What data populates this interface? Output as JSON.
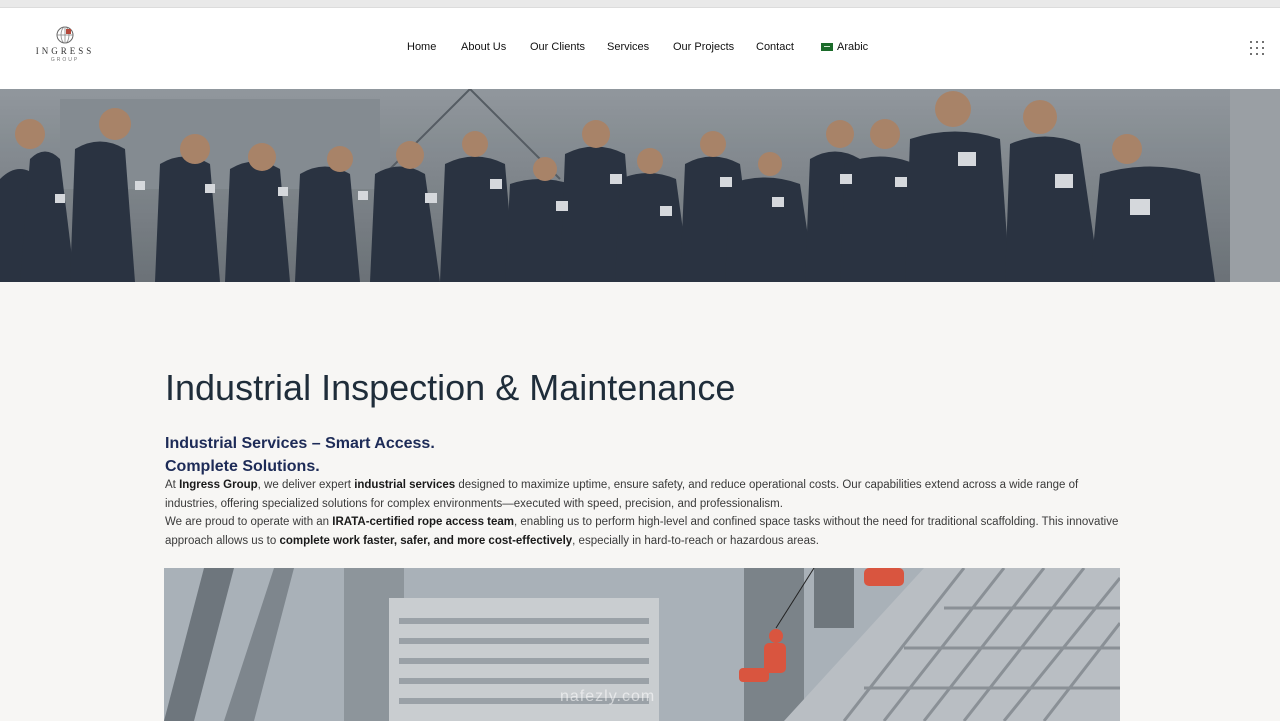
{
  "brand": {
    "name": "INGRESS",
    "tagline": "GROUP"
  },
  "nav": {
    "home": "Home",
    "about": "About Us",
    "clients": "Our Clients",
    "services": "Services",
    "projects": "Our Projects",
    "contact": "Contact",
    "language": "Arabic"
  },
  "main": {
    "title": "Industrial Inspection & Maintenance",
    "subtitle_line1": "Industrial Services – Smart Access.",
    "subtitle_line2": "Complete Solutions.",
    "p1": {
      "a": "At ",
      "b": "Ingress Group",
      "c": ", we deliver expert ",
      "d": "industrial services",
      "e": " designed to maximize uptime, ensure safety, and reduce operational costs. Our capabilities extend across a wide range of industries, offering specialized solutions for complex environments—executed with speed, precision, and professionalism."
    },
    "p2": {
      "a": "We are proud to operate with an ",
      "b": "IRATA-certified rope access team",
      "c": ", enabling us to perform high-level and confined space tasks without the need for traditional scaffolding. This innovative approach allows us to ",
      "d": "complete work faster, safer, and more cost-effectively",
      "e": ", especially in hard-to-reach or hazardous areas."
    }
  },
  "watermark": "nafezly.com",
  "colors": {
    "heading": "#1f2d3a",
    "subheading": "#1d2b57",
    "jacket": "#2b3442"
  },
  "icons": {
    "menu": "grid-dots-icon",
    "flag": "saudi-flag-icon"
  }
}
